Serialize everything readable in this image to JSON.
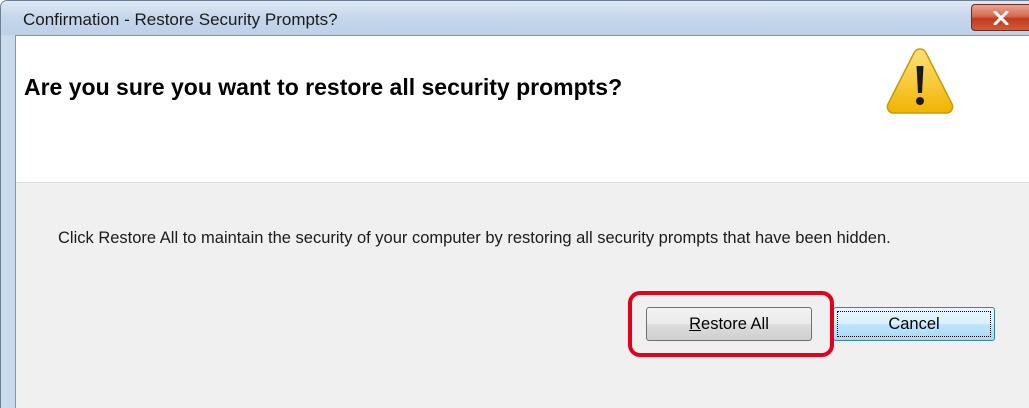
{
  "window": {
    "title": "Confirmation - Restore Security Prompts?",
    "close_icon": "close-x-icon"
  },
  "dialog": {
    "main_instruction": "Are you sure you want to restore all security prompts?",
    "icon": "warning-icon",
    "body_text": "Click Restore All to maintain the security of your computer by restoring all security prompts that have been hidden."
  },
  "buttons": {
    "restore_all_prefix": "",
    "restore_all_mnemonic": "R",
    "restore_all_rest": "estore All",
    "cancel_label": "Cancel",
    "default_button": "Cancel"
  },
  "annotation": {
    "highlight_color": "#e3001b",
    "highlighted_element": "Restore All"
  },
  "colors": {
    "close_button": "#c13b1d",
    "warning_yellow": "#f5c400"
  }
}
